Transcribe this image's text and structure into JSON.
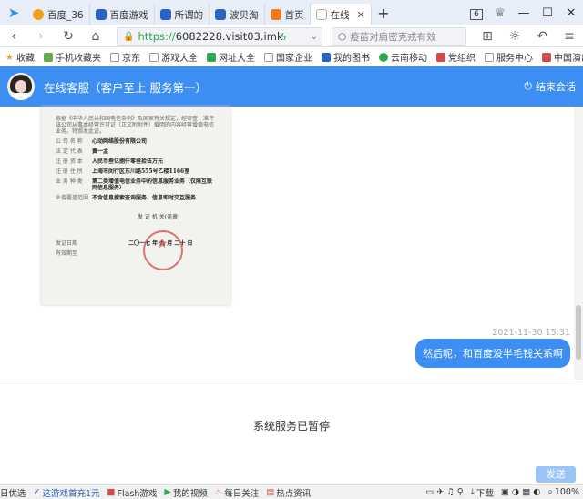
{
  "tabs": [
    {
      "label": "百度_36",
      "color": "#f0a020"
    },
    {
      "label": "百度游戏",
      "color": "#2a62c4"
    },
    {
      "label": "所谓的",
      "color": "#2a62c4"
    },
    {
      "label": "波贝淘",
      "color": "#2a62c4"
    },
    {
      "label": "首页",
      "color": "#f07a20"
    },
    {
      "label": "在线",
      "color": "#cccccc"
    }
  ],
  "tab_count": "6",
  "url": {
    "scheme": "https://",
    "host": "6082228.visit03.imk"
  },
  "search": {
    "placeholder": "疫苗对肩密克戎有效"
  },
  "bookmarks": [
    "收藏",
    "手机收藏夹",
    "京东",
    "游戏大全",
    "网址大全",
    "国家企业",
    "我的图书",
    "云南移动",
    "党组织",
    "服务中心",
    "中国演出"
  ],
  "chat": {
    "title": "在线客服（客户至上 服务第一）",
    "end_label": "结束会话",
    "doc": {
      "header": "根据《中华人民共和国电信条例》及国家有关规定，经审查，准许该公司从事本经营许可证（正文附附件）载明的内容经营增值电信业务。特颁发此证。",
      "rows": [
        {
          "label": "公 司 名 称",
          "value": "心动网络股份有限公司"
        },
        {
          "label": "法 定 代 表",
          "value": "黄一孟"
        },
        {
          "label": "注 册 资 本",
          "value": "人民币叁亿捌仟零叁拾伍万元"
        },
        {
          "label": "注 册 住 所",
          "value": "上海市闵行区东川路555号乙楼1166室"
        },
        {
          "label": "业 务 种 类",
          "value": "第二类增值电信业务中的信息服务业务（仅限互联网信息服务）"
        },
        {
          "label": "业务覆盖范围",
          "value": "不含信息搜索查询服务、信息即时交互服务"
        }
      ],
      "sign_label": "发 证 机 关(盖章)",
      "date_label": "发证日期",
      "date_value": "二〇一七 年 九 月 二十 日",
      "validity_label": "有效期至"
    },
    "timestamp": "2021-11-30 15:31",
    "message": "然后呢，和百度没半毛钱关系啊",
    "paused": "系统服务已暂停",
    "send_label": "发送"
  },
  "status": [
    {
      "label": "日优选",
      "color": "#333333"
    },
    {
      "label": "这游戏首充1元",
      "color": "#2a62c4"
    },
    {
      "label": "Flash游戏",
      "color": "#333333"
    },
    {
      "label": "我的视频",
      "color": "#333333"
    },
    {
      "label": "每日关注",
      "color": "#333333"
    },
    {
      "label": "热点资讯",
      "color": "#333333"
    },
    {
      "label": "下载",
      "color": "#333333"
    },
    {
      "label": "100%",
      "color": "#333333"
    }
  ]
}
